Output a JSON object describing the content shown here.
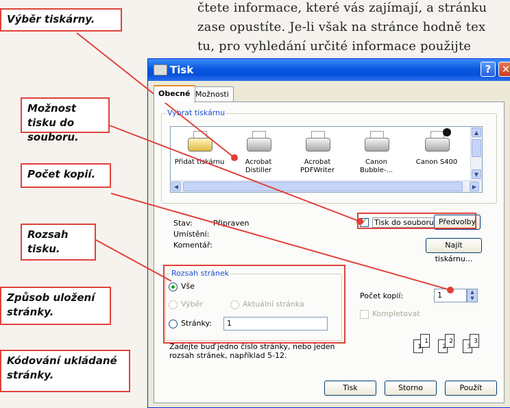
{
  "book_text": [
    "čtete informace, které vás zajímají, a stránku",
    "zase opustíte. Je-li však na stránce hodně tex",
    "tu, pro vyhledání určité informace použijte"
  ],
  "callouts": {
    "printer": "Výběr tiskárny.",
    "file": "Možnost tisku do souboru.",
    "copies": "Počet kopií.",
    "range": "Rozsah tisku.",
    "save": "Způsob uložení stránky.",
    "encoding": "Kódování ukládané stránky."
  },
  "dialog": {
    "title": "Tisk",
    "help_glyph": "?",
    "close_glyph": "✕",
    "tabs": [
      "Obecné",
      "Možnosti"
    ],
    "printer_group": "Vybrat tiskárnu",
    "printers": [
      {
        "name": "Přidat tiskárnu",
        "icon": "add-printer-icon"
      },
      {
        "name": "Acrobat Distiller",
        "icon": "printer-icon"
      },
      {
        "name": "Acrobat PDFWriter",
        "icon": "printer-icon"
      },
      {
        "name": "Canon Bubble-...",
        "icon": "printer-icon"
      },
      {
        "name": "Canon S400",
        "icon": "printer-default-icon"
      }
    ],
    "status_label": "Stav:",
    "status_value": "Připraven",
    "location_label": "Umístění:",
    "comment_label": "Komentář:",
    "print_to_file": "Tisk do souboru",
    "preferences": "Předvolby",
    "find_printer": "Najít tiskárnu...",
    "range_group": "Rozsah stránek",
    "range_all": "Vše",
    "range_selection": "Výběr",
    "range_current": "Aktuální stránka",
    "range_pages": "Stránky:",
    "pages_value": "1",
    "range_hint": "Zadejte buď jedno číslo stránky, nebo jeden rozsah stránek, například 5-12.",
    "copies_label": "Počet kopií:",
    "copies_value": "1",
    "collate": "Kompletovat",
    "collate_pages": [
      "1",
      "1",
      "2",
      "2",
      "3",
      "3"
    ],
    "buttons": {
      "print": "Tisk",
      "cancel": "Storno",
      "apply": "Použít"
    }
  },
  "accent_color": "#e0413a"
}
